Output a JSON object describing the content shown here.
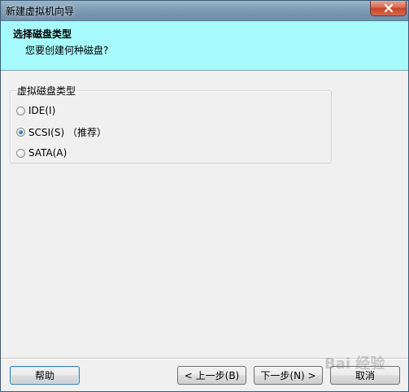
{
  "window": {
    "title": "新建虚拟机向导",
    "close_icon": "close-icon"
  },
  "header": {
    "title": "选择磁盘类型",
    "subtitle": "您要创建何种磁盘?",
    "background": "#a7fafc"
  },
  "group": {
    "label": "虚拟磁盘类型",
    "options": [
      {
        "label": "IDE(I)",
        "checked": false
      },
      {
        "label": "SCSI(S) （推荐）",
        "checked": true
      },
      {
        "label": "SATA(A)",
        "checked": false
      }
    ]
  },
  "buttons": {
    "help": "帮助",
    "back": "< 上一步(B)",
    "next": "下一步(N) >",
    "cancel": "取消"
  },
  "watermark": {
    "text": "Bai 经验"
  }
}
